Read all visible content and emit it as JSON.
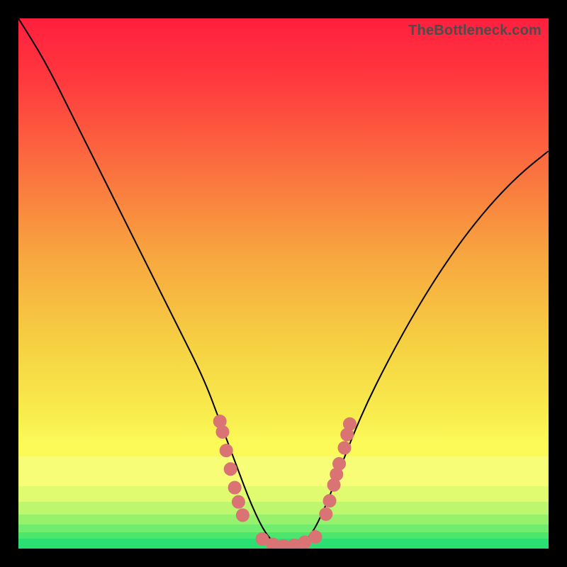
{
  "watermark": "TheBottleneck.com",
  "colors": {
    "frame": "#000000",
    "curve": "#000000",
    "marker_fill": "#d97374",
    "marker_stroke": "#d97374",
    "bottom_band_1": "#2bdf71",
    "bottom_band_2": "#4ce66f",
    "bottom_band_3": "#70ec6e",
    "bottom_band_4": "#97f16d",
    "bottom_band_5": "#bef66d",
    "bottom_band_6": "#e0fb6f",
    "bottom_band_7": "#f7fd77",
    "grad_top": "#ff213e",
    "grad_mid": "#f7b43f",
    "grad_low": "#faf451"
  },
  "chart_data": {
    "type": "line",
    "title": "",
    "xlabel": "",
    "ylabel": "",
    "xlim": [
      0,
      100
    ],
    "ylim": [
      0,
      100
    ],
    "series": [
      {
        "name": "bottleneck-curve",
        "x": [
          0,
          5,
          10,
          15,
          20,
          25,
          30,
          35,
          38,
          41,
          44,
          47,
          50,
          52,
          55,
          58,
          61,
          65,
          70,
          75,
          80,
          85,
          90,
          95,
          100
        ],
        "y": [
          100,
          92,
          82,
          72,
          62,
          52,
          42,
          32,
          24,
          16,
          8,
          2,
          0,
          0,
          2,
          8,
          16,
          26,
          36,
          45,
          53,
          60,
          66,
          71,
          75
        ]
      }
    ],
    "markers": {
      "left_cluster": [
        [
          38,
          24
        ],
        [
          38.5,
          22
        ],
        [
          39.2,
          18.5
        ],
        [
          40,
          15
        ],
        [
          40.8,
          11.5
        ],
        [
          41.5,
          8.8
        ],
        [
          42.3,
          6.3
        ]
      ],
      "bottom_cluster": [
        [
          46,
          1.8
        ],
        [
          48,
          0.8
        ],
        [
          50,
          0.5
        ],
        [
          52,
          0.6
        ],
        [
          54,
          1.2
        ],
        [
          56,
          2.2
        ]
      ],
      "right_cluster": [
        [
          58,
          6.5
        ],
        [
          58.7,
          9
        ],
        [
          59.5,
          12
        ],
        [
          60,
          14
        ],
        [
          60.5,
          16
        ],
        [
          61.5,
          19
        ],
        [
          62,
          21.5
        ],
        [
          62.5,
          23.5
        ]
      ]
    }
  }
}
